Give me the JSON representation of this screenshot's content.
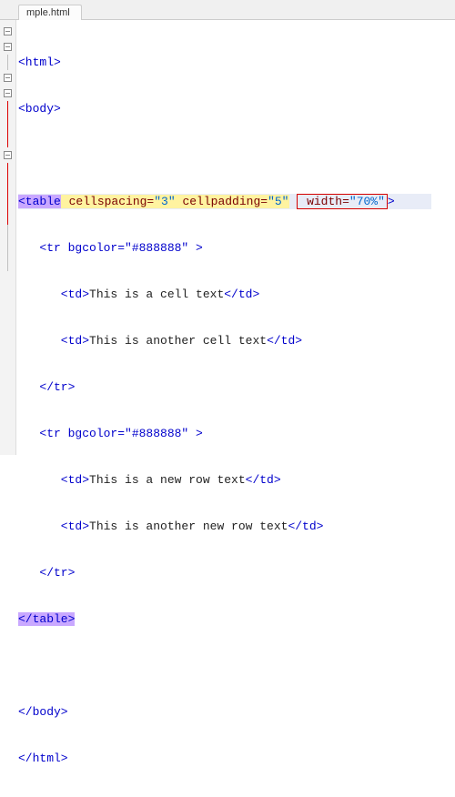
{
  "tab": {
    "filename": "mple.html"
  },
  "code": {
    "line1": "<html>",
    "line2": "<body>",
    "line3": "",
    "line4_open": "<table",
    "line4_attr1_name": " cellspacing=",
    "line4_attr1_val": "\"3\"",
    "line4_attr2_name": " cellpadding=",
    "line4_attr2_val": "\"5\"",
    "line4_attr3_name": " width=",
    "line4_attr3_val": "\"70%\"",
    "line4_close": ">",
    "line5": "   <tr bgcolor=\"#888888\" >",
    "line6_pre": "      <td>",
    "line6_txt": "This is a cell text",
    "line6_post": "</td>",
    "line7_pre": "      <td>",
    "line7_txt": "This is another cell text",
    "line7_post": "</td>",
    "line8": "   </tr>",
    "line9": "   <tr bgcolor=\"#888888\" >",
    "line10_pre": "      <td>",
    "line10_txt": "This is a new row text",
    "line10_post": "</td>",
    "line11_pre": "      <td>",
    "line11_txt": "This is another new row text",
    "line11_post": "</td>",
    "line12": "   </tr>",
    "line13": "</table>",
    "line14": "",
    "line15": "</body>",
    "line16": "</html>"
  }
}
